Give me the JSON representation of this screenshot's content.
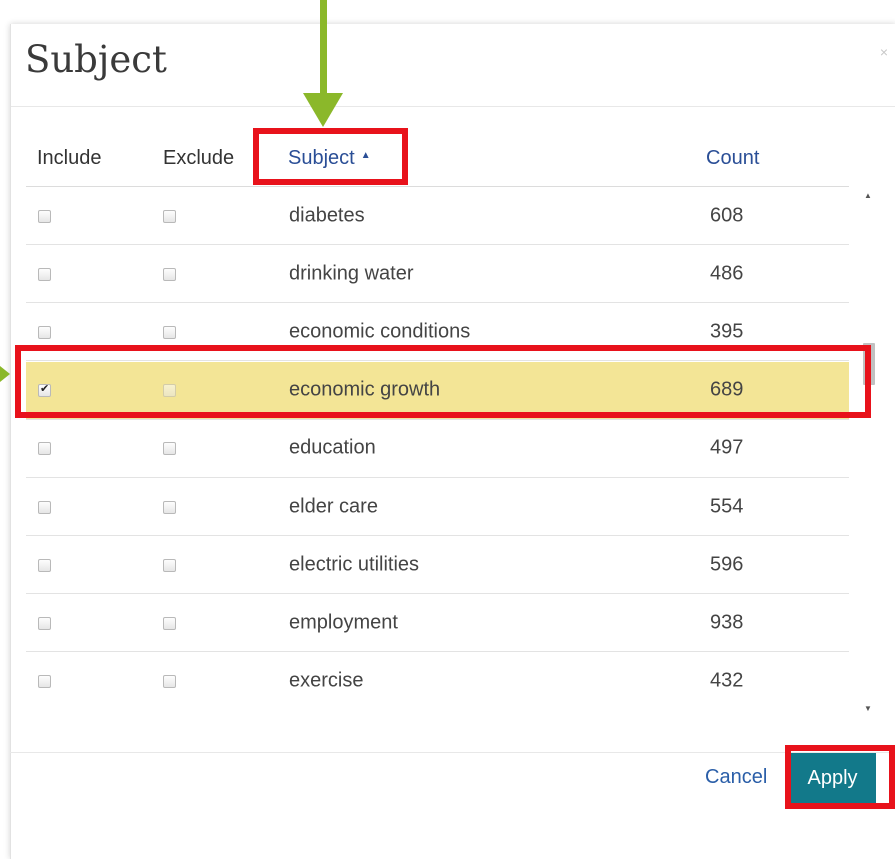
{
  "dialog": {
    "title": "Subject",
    "close_icon": "close-icon",
    "close_glyph": "×"
  },
  "columns": {
    "include": "Include",
    "exclude": "Exclude",
    "subject": "Subject",
    "count": "Count",
    "sort_icon": "sort-ascending-icon",
    "sort_glyph": "▲"
  },
  "rows": [
    {
      "subject": "diabetes",
      "count": "608",
      "include": false,
      "exclude": false
    },
    {
      "subject": "drinking water",
      "count": "486",
      "include": false,
      "exclude": false
    },
    {
      "subject": "economic conditions",
      "count": "395",
      "include": false,
      "exclude": false
    },
    {
      "subject": "economic growth",
      "count": "689",
      "include": true,
      "exclude": false,
      "selected": true
    },
    {
      "subject": "education",
      "count": "497",
      "include": false,
      "exclude": false
    },
    {
      "subject": "elder care",
      "count": "554",
      "include": false,
      "exclude": false
    },
    {
      "subject": "electric utilities",
      "count": "596",
      "include": false,
      "exclude": false
    },
    {
      "subject": "employment",
      "count": "938",
      "include": false,
      "exclude": false
    },
    {
      "subject": "exercise",
      "count": "432",
      "include": false,
      "exclude": false
    }
  ],
  "scrollbar": {
    "up_glyph": "▲",
    "down_glyph": "▼"
  },
  "footer": {
    "cancel_label": "Cancel",
    "apply_label": "Apply"
  },
  "colors": {
    "selected_row": "#f3e596",
    "apply_button": "#12798a",
    "link": "#2a5ea8",
    "annotation_box": "#e8121b",
    "annotation_arrow": "#8bb82a"
  }
}
